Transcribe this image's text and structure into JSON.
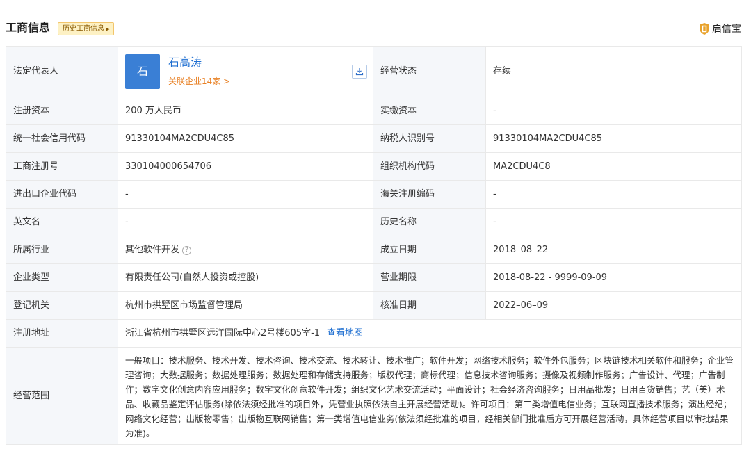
{
  "header": {
    "title": "工商信息",
    "history_tag": "历史工商信息",
    "brand_name": "启信宝",
    "brand_color": "#e8a22c"
  },
  "legal_rep": {
    "label": "法定代表人",
    "avatar_char": "石",
    "name": "石高涛",
    "related": "关联企业14家 >",
    "download_icon": "download-icon"
  },
  "rows": {
    "status": {
      "label": "经营状态",
      "value": "存续"
    },
    "reg_capital": {
      "label": "注册资本",
      "value": "200 万人民币"
    },
    "paid_capital": {
      "label": "实缴资本",
      "value": "-"
    },
    "credit_code": {
      "label": "统一社会信用代码",
      "value": "91330104MA2CDU4C85"
    },
    "taxpayer_id": {
      "label": "纳税人识别号",
      "value": "91330104MA2CDU4C85"
    },
    "reg_number": {
      "label": "工商注册号",
      "value": "330104000654706"
    },
    "org_code": {
      "label": "组织机构代码",
      "value": "MA2CDU4C8"
    },
    "ie_code": {
      "label": "进出口企业代码",
      "value": "-"
    },
    "customs_code": {
      "label": "海关注册编码",
      "value": "-"
    },
    "english_name": {
      "label": "英文名",
      "value": "-"
    },
    "former_name": {
      "label": "历史名称",
      "value": "-"
    },
    "industry": {
      "label": "所属行业",
      "value": "其他软件开发"
    },
    "founded": {
      "label": "成立日期",
      "value": "2018–08–22"
    },
    "company_type": {
      "label": "企业类型",
      "value": "有限责任公司(自然人投资或控股)"
    },
    "term": {
      "label": "营业期限",
      "value": "2018-08-22 - 9999-09-09"
    },
    "authority": {
      "label": "登记机关",
      "value": "杭州市拱墅区市场监督管理局"
    },
    "approval_date": {
      "label": "核准日期",
      "value": "2022–06–09"
    },
    "address": {
      "label": "注册地址",
      "value": "浙江省杭州市拱墅区远洋国际中心2号楼605室-1",
      "map_link": "查看地图"
    },
    "scope": {
      "label": "经营范围",
      "value": "一般项目：技术服务、技术开发、技术咨询、技术交流、技术转让、技术推广；软件开发；网络技术服务；软件外包服务；区块链技术相关软件和服务；企业管理咨询；大数据服务；数据处理服务；数据处理和存储支持服务；版权代理；商标代理；信息技术咨询服务；摄像及视频制作服务；广告设计、代理；广告制作；数字文化创意内容应用服务；数字文化创意软件开发；组织文化艺术交流活动；平面设计；社会经济咨询服务；日用品批发；日用百货销售；艺（美）术品、收藏品鉴定评估服务(除依法须经批准的项目外，凭营业执照依法自主开展经营活动)。许可项目：第二类增值电信业务；互联网直播技术服务；演出经纪；网络文化经营；出版物零售；出版物互联网销售；第一类增值电信业务(依法须经批准的项目，经相关部门批准后方可开展经营活动，具体经营项目以审批结果为准)。"
    }
  }
}
